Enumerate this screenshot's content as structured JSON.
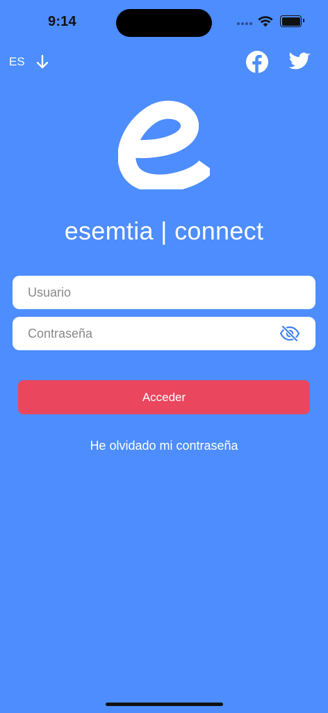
{
  "status_bar": {
    "time": "9:14",
    "battery_level": 1.0
  },
  "header": {
    "language": "ES",
    "language_icon": "arrow-down-icon",
    "social_icons": [
      "facebook-icon",
      "twitter-icon"
    ]
  },
  "brand": {
    "logo_icon": "esemtia-e-logo",
    "title": "esemtia | connect"
  },
  "login_form": {
    "username_placeholder": "Usuario",
    "password_placeholder": "Contraseña",
    "password_toggle_icon": "eye-slash-icon",
    "submit_label": "Acceder",
    "forgot_password_label": "He olvidado mi contraseña"
  },
  "colors": {
    "background": "#4d8dfd",
    "button": "#ea465e",
    "field": "#ffffff",
    "icon_accent": "#3e7ff0"
  }
}
